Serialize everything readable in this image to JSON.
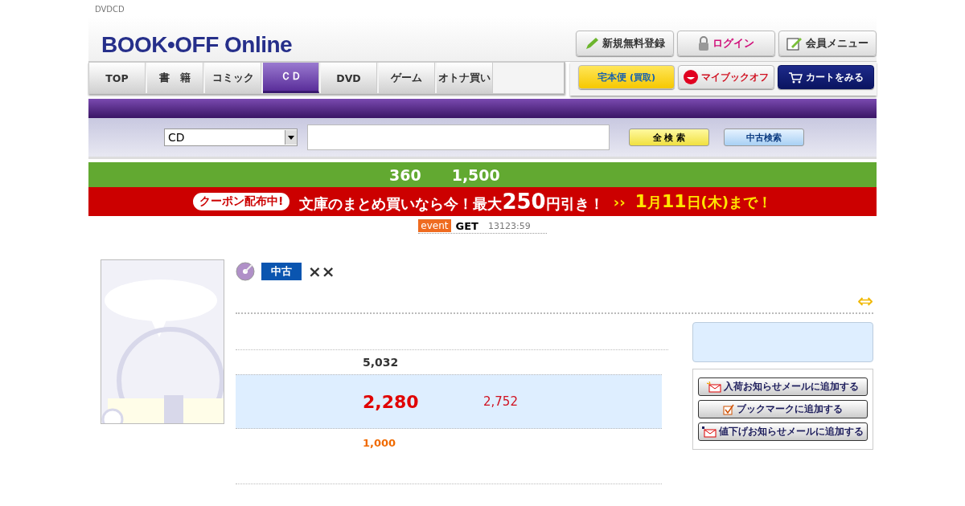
{
  "breadcrumb": "DVDCD",
  "logo": {
    "text": "BOOK•OFF Online"
  },
  "account_buttons": [
    {
      "label": "新規無料登録",
      "kind": "pencil"
    },
    {
      "label": "ログイン",
      "kind": "lock"
    },
    {
      "label": "会員メニュー",
      "kind": "notepad"
    }
  ],
  "tabs": [
    {
      "label": "TOP",
      "selected": false
    },
    {
      "label": "書　籍",
      "selected": false
    },
    {
      "label": "コミック",
      "selected": false
    },
    {
      "label": "ＣＤ",
      "selected": true
    },
    {
      "label": "DVD",
      "selected": false
    },
    {
      "label": "ゲーム",
      "selected": false
    },
    {
      "label": "オトナ買い",
      "selected": false
    }
  ],
  "service_buttons": [
    {
      "label": "宅本便",
      "sub": "(買取)",
      "kind": "takuhon"
    },
    {
      "label": "マイブックオフ",
      "kind": "mybookoff"
    },
    {
      "label": "カートをみる",
      "kind": "cart"
    }
  ],
  "search": {
    "category": "CD",
    "buttons": [
      {
        "label": "全 検 索",
        "kind": "all"
      },
      {
        "label": "中古検索",
        "kind": "used"
      }
    ]
  },
  "promo_bar": {
    "texts": [
      "360",
      "1,500"
    ]
  },
  "coupon_banner": {
    "badge": "クーポン配布中!",
    "message": "文庫のまとめ買いなら今！最大**250**円引き！",
    "arrow": "››",
    "deadline": "**1**月**11**日(木)まで！"
  },
  "event_line": {
    "tag": "event",
    "label": "GET",
    "time": "13123:59"
  },
  "product": {
    "condition": "中古",
    "title": "××",
    "swap_icon": "⇔",
    "list_price": "5,032",
    "price": "2,280",
    "discount": "2,752",
    "points": "1,000",
    "actions": [
      {
        "label": "入荷お知らせメールに追加する",
        "kind": "mail"
      },
      {
        "label": "ブックマークに追加する",
        "kind": "check"
      },
      {
        "label": "値下げお知らせメールに追加する",
        "kind": "mail-down"
      }
    ]
  }
}
